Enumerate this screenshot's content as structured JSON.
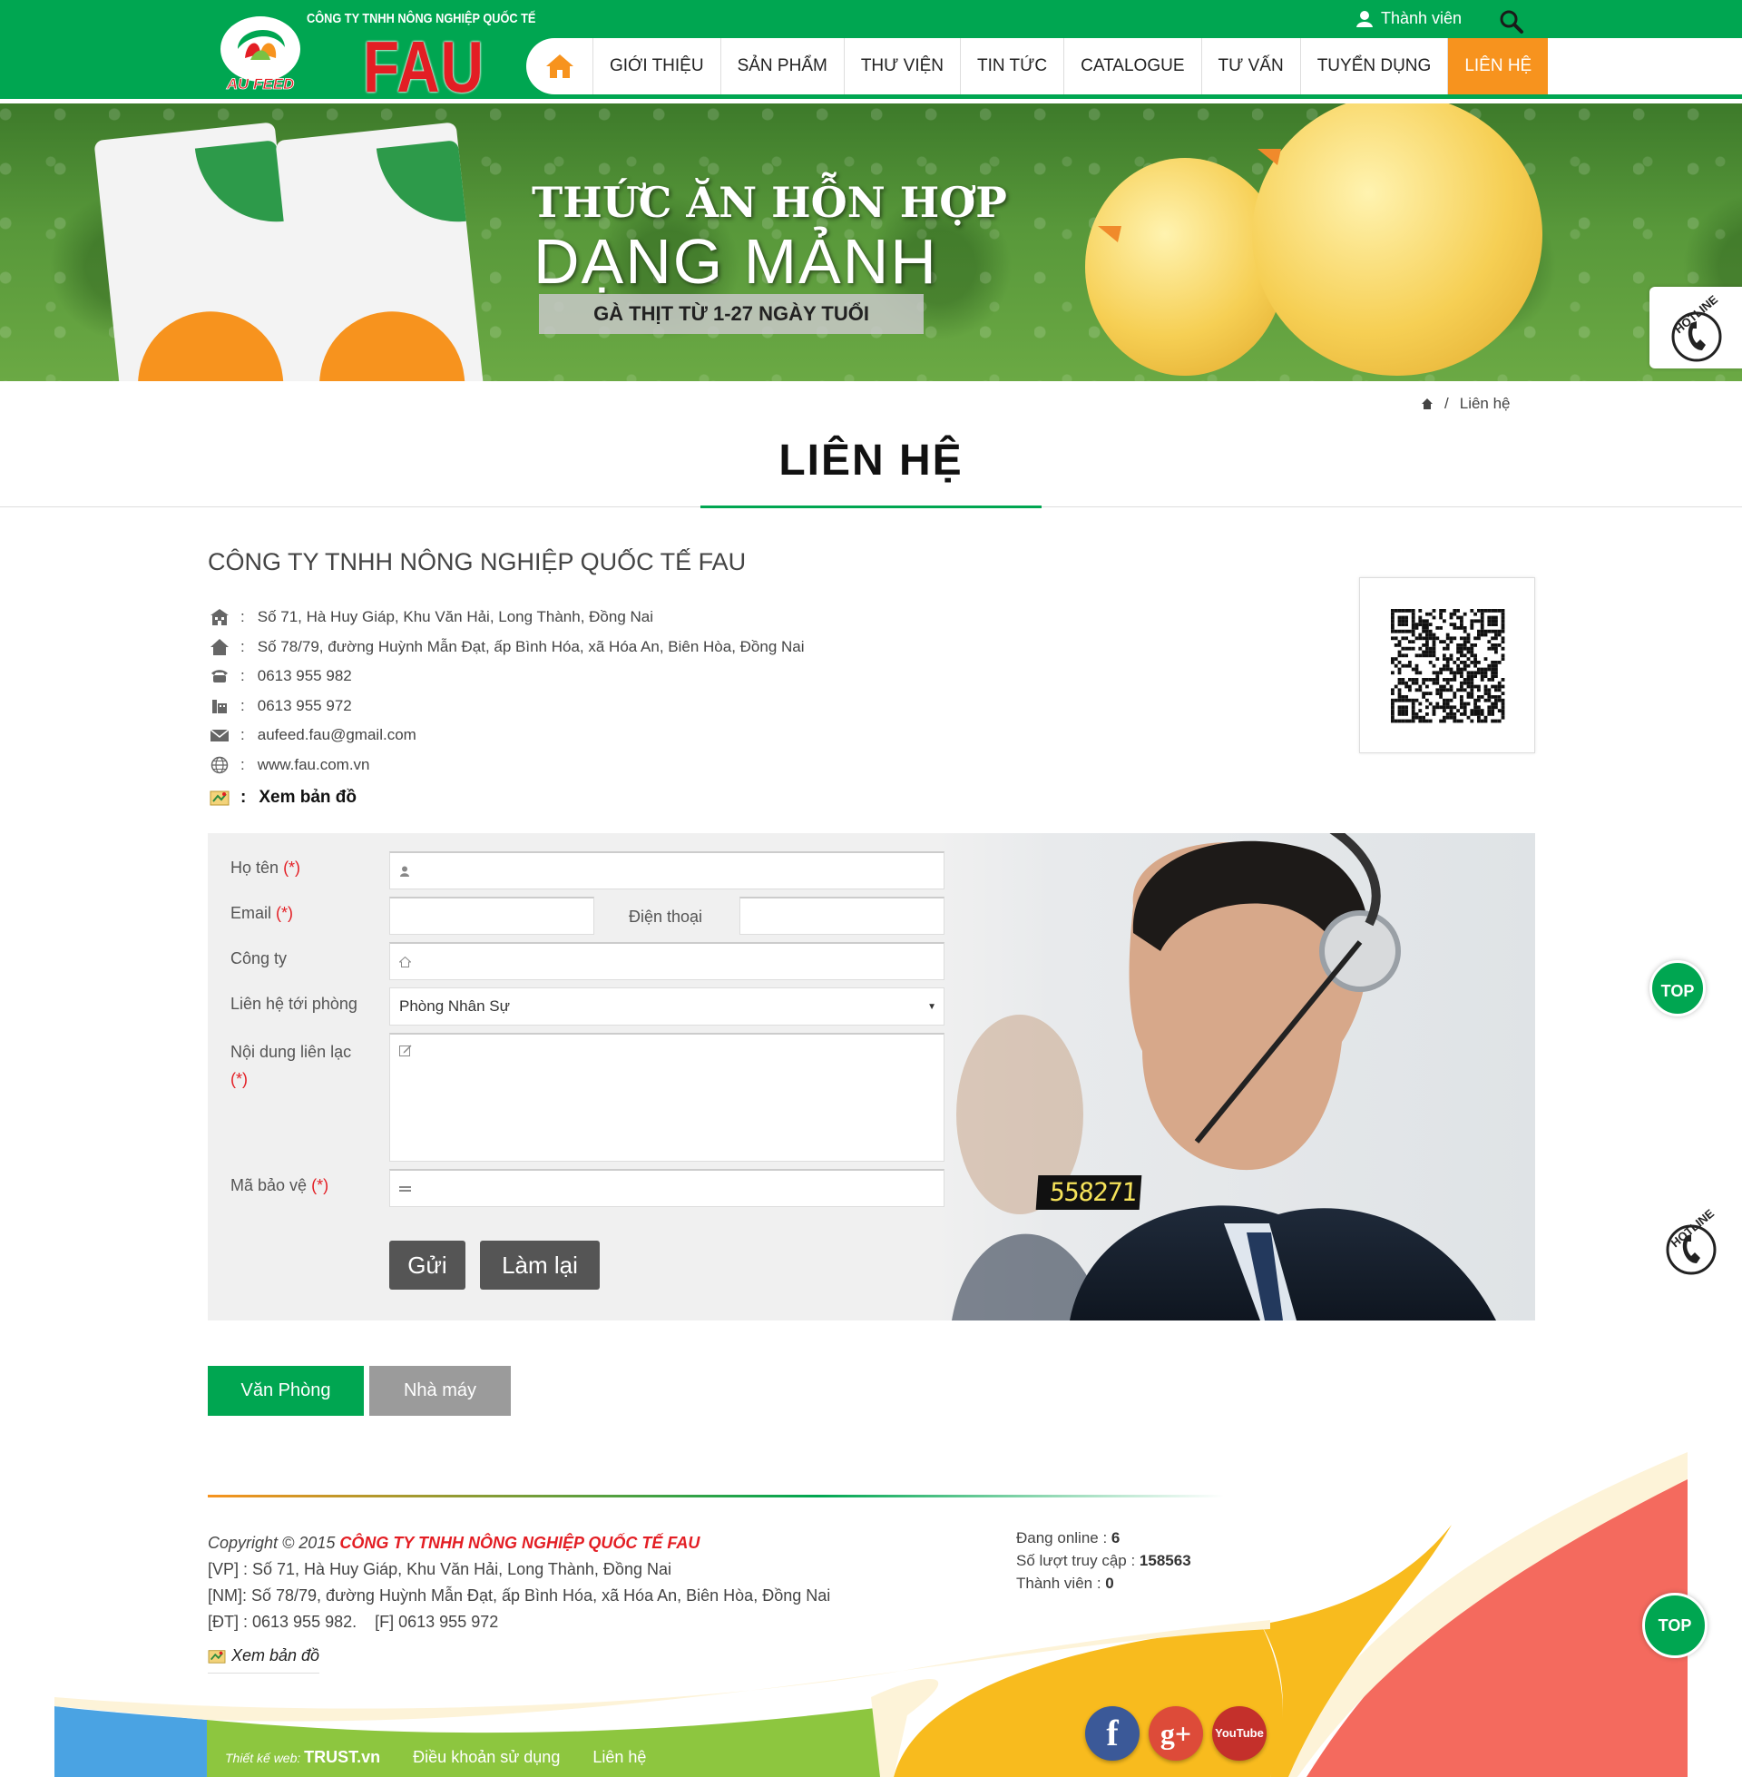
{
  "header": {
    "company_line": "CÔNG TY TNHH NÔNG NGHIỆP QUỐC TẾ",
    "brand": "FAU",
    "logo_text": "AU FEED",
    "member_label": "Thành viên"
  },
  "nav": {
    "items": [
      "GIỚI THIỆU",
      "SẢN PHẨM",
      "THƯ VIỆN",
      "TIN TỨC",
      "CATALOGUE",
      "TƯ VẤN",
      "TUYỂN DỤNG",
      "LIÊN HỆ"
    ],
    "active": "LIÊN HỆ"
  },
  "banner": {
    "title_line1": "THỨC ĂN HỖN HỢP",
    "title_line2": "DẠNG MẢNH",
    "subtitle": "GÀ THỊT TỪ 1-27 NGÀY TUỔI"
  },
  "hotline_label": "HOTLINE",
  "breadcrumb": {
    "current": "Liên hệ",
    "separator": "/"
  },
  "page_title": "LIÊN HỆ",
  "contact": {
    "company_name": "CÔNG TY TNHH NÔNG NGHIỆP QUỐC TẾ FAU",
    "address_office": "Số 71, Hà Huy Giáp, Khu Văn Hải, Long Thành, Đồng Nai",
    "address_factory": "Số 78/79, đường Huỳnh Mẫn Đạt, ấp Bình Hóa, xã Hóa An, Biên Hòa, Đồng Nai",
    "phone": "0613 955 982",
    "fax": "0613 955 972",
    "email": "aufeed.fau@gmail.com",
    "website": "www.fau.com.vn",
    "map_link": "Xem bản đồ",
    "colon": ":"
  },
  "form": {
    "name_label": "Họ tên",
    "email_label": "Email",
    "phone_label": "Điện thoại",
    "company_label": "Công ty",
    "department_label": "Liên hệ tới phòng",
    "department_selected": "Phòng Nhân Sự",
    "message_label": "Nội dung liên lạc",
    "captcha_label": "Mã bảo vệ",
    "required_mark": "(*)",
    "captcha_code": "558271",
    "submit": "Gửi",
    "reset": "Làm lại"
  },
  "tabs": [
    "Văn Phòng",
    "Nhà máy"
  ],
  "footer": {
    "copyright_prefix": "Copyright © 2015",
    "company": "CÔNG TY TNHH NÔNG NGHIỆP QUỐC TẾ FAU",
    "vp": "[VP] : Số 71, Hà Huy Giáp, Khu Văn Hải, Long Thành, Đồng Nai",
    "nm": "[NM]: Số 78/79, đường Huỳnh Mẫn Đạt, ấp Bình Hóa, xã Hóa An, Biên Hòa, Đồng Nai",
    "dt": "[ĐT] : 0613 955 982.",
    "f": "[F] 0613 955 972",
    "map_link": "Xem bản đồ",
    "online_label": "Đang online :",
    "online_value": "6",
    "visits_label": "Số lượt truy cập :",
    "visits_value": "158563",
    "members_label": "Thành viên :",
    "members_value": "0",
    "design_prefix": "Thiết kế web:",
    "design_brand": "TRUST.vn",
    "terms": "Điều khoản sử dụng",
    "contact": "Liên hệ"
  },
  "social": {
    "facebook": "f",
    "googleplus": "g+",
    "youtube": "YouTube"
  },
  "top_label": "TOP",
  "colors": {
    "green": "#00a651",
    "orange": "#f7931e",
    "red": "#e31e24",
    "button_gray": "#555555",
    "tab_gray": "#9b9b9b"
  }
}
